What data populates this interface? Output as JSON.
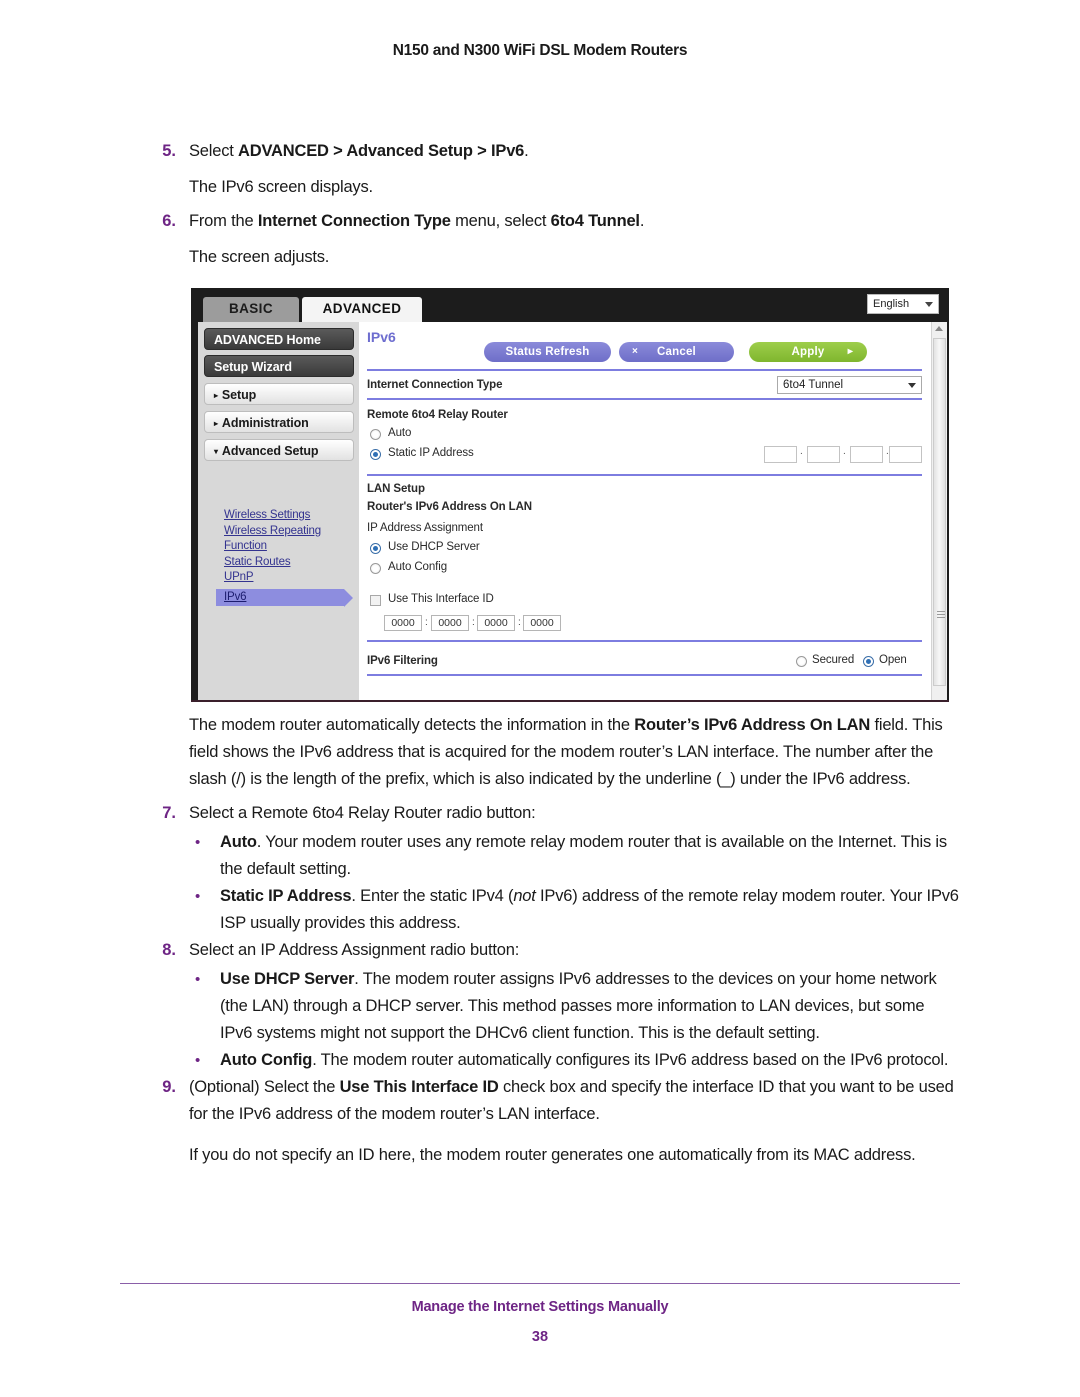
{
  "header": {
    "title": "N150 and N300 WiFi DSL Modem Routers"
  },
  "steps": {
    "s5": {
      "num": "5.",
      "text_pre": "Select ",
      "bold1": "ADVANCED > Advanced Setup > IPv6",
      "text_post": ".",
      "result": "The IPv6 screen displays."
    },
    "s6": {
      "num": "6.",
      "text_pre": "From the ",
      "bold1": "Internet Connection Type",
      "text_mid": " menu, select ",
      "bold2": "6to4 Tunnel",
      "text_post": ".",
      "result": "The screen adjusts."
    },
    "s7": {
      "num": "7.",
      "text": "Select a Remote 6to4 Relay Router radio button:",
      "bullets": [
        {
          "bold": "Auto",
          "text": ". Your modem router uses any remote relay modem router that is available on the Internet. This is the default setting."
        },
        {
          "bold": "Static IP Address",
          "text_a": ". Enter the static IPv4 (",
          "italic": "not",
          "text_b": " IPv6) address of the remote relay modem router. Your IPv6 ISP usually provides this address."
        }
      ]
    },
    "s8": {
      "num": "8.",
      "text": "Select an IP Address Assignment radio button:",
      "bullets": [
        {
          "bold": "Use DHCP Server",
          "text": ". The modem router assigns IPv6 addresses to the devices on your home network (the LAN) through a DHCP server. This method passes more information to LAN devices, but some IPv6 systems might not support the DHCv6 client function. This is the default setting."
        },
        {
          "bold": "Auto Config",
          "text": ". The modem router automatically configures its IPv6 address based on the IPv6 protocol."
        }
      ]
    },
    "s9": {
      "num": "9.",
      "text_pre": "(Optional) Select the ",
      "bold1": "Use This Interface ID",
      "text_post": " check box and specify the interface ID that you want to be used for the IPv6 address of the modem router’s LAN interface.",
      "result": "If you do not specify an ID here, the modem router generates one automatically from its MAC address."
    }
  },
  "detect_para": {
    "text_pre": "The modem router automatically detects the information in the ",
    "bold1": "Router’s IPv6 Address On LAN",
    "text_post": " field. This field shows the IPv6 address that is acquired for the modem router’s LAN interface. The number after the slash (/) is the length of the prefix, which is also indicated by the underline (_) under the IPv6 address."
  },
  "bullet_glyph": "•",
  "screenshot": {
    "tabs": [
      {
        "label": "BASIC",
        "active": false
      },
      {
        "label": "ADVANCED",
        "active": true
      }
    ],
    "language": {
      "value": "English"
    },
    "sidebar": {
      "buttons": [
        {
          "label": "ADVANCED Home",
          "style": "dark"
        },
        {
          "label": "Setup Wizard",
          "style": "dark"
        },
        {
          "label": "Setup",
          "style": "light",
          "arrow": "▸"
        },
        {
          "label": "Administration",
          "style": "light",
          "arrow": "▸"
        },
        {
          "label": "Advanced Setup",
          "style": "light",
          "arrow": "▾"
        }
      ],
      "links": [
        "Wireless Settings",
        "Wireless Repeating",
        "Function",
        "Static Routes",
        "UPnP"
      ],
      "active_link": "IPv6"
    },
    "panel": {
      "title": "IPv6",
      "buttons": {
        "refresh": "Status Refresh",
        "cancel": "Cancel",
        "cancel_icon": "×",
        "apply": "Apply",
        "apply_icon": "▸"
      },
      "connection_type_label": "Internet Connection Type",
      "connection_type_value": "6to4 Tunnel",
      "relay_section": {
        "heading": "Remote 6to4 Relay Router",
        "options": [
          {
            "label": "Auto",
            "selected": false
          },
          {
            "label": "Static IP Address",
            "selected": true
          }
        ],
        "ip_octets": [
          "",
          "",
          "",
          ""
        ],
        "ip_separator": "."
      },
      "lan_section": {
        "heading": "LAN Setup",
        "subheading": "Router's IPv6 Address On LAN",
        "assignment_label": "IP Address Assignment",
        "options": [
          {
            "label": "Use DHCP Server",
            "selected": true
          },
          {
            "label": "Auto Config",
            "selected": false
          }
        ],
        "interface_id_label": "Use This Interface ID",
        "interface_id_checked": false,
        "hex_groups": [
          "0000",
          "0000",
          "0000",
          "0000"
        ],
        "hex_separator": ":"
      },
      "filtering": {
        "label": "IPv6 Filtering",
        "options": [
          {
            "label": "Secured",
            "selected": false
          },
          {
            "label": "Open",
            "selected": true
          }
        ]
      }
    }
  },
  "footer": {
    "title": "Manage the Internet Settings Manually",
    "page": "38"
  },
  "colors": {
    "accent_purple": "#6e2585",
    "link_blue": "#33338f",
    "highlight": "#8d8ddf",
    "apply_green": "#7fb62e",
    "button_purple": "#6e6ec8"
  }
}
